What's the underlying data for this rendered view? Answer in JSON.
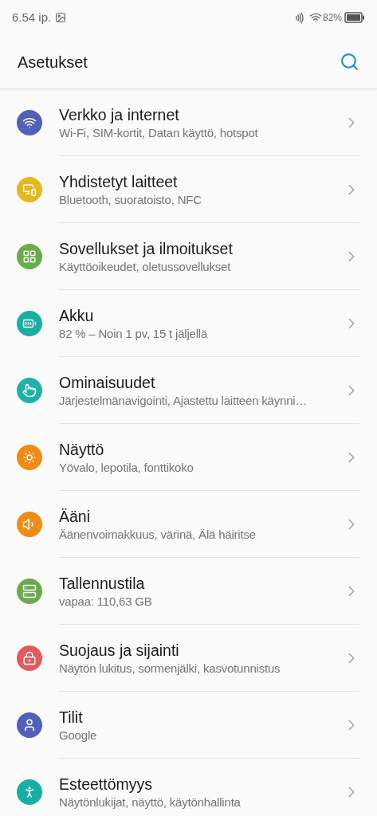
{
  "status_bar": {
    "time": "6.54 ip.",
    "battery": "82%"
  },
  "header": {
    "title": "Asetukset"
  },
  "items": [
    {
      "title": "Verkko ja internet",
      "subtitle": "Wi-Fi, SIM-kortit, Datan käyttö, hotspot",
      "color": "#5160b8"
    },
    {
      "title": "Yhdistetyt laitteet",
      "subtitle": "Bluetooth, suoratoisto, NFC",
      "color": "#e6b81e"
    },
    {
      "title": "Sovellukset ja ilmoitukset",
      "subtitle": "Käyttöoikeudet, oletussovellukset",
      "color": "#6aab4c"
    },
    {
      "title": "Akku",
      "subtitle": "82 % – Noin 1 pv, 15 t jäljellä",
      "color": "#19ada3"
    },
    {
      "title": "Ominaisuudet",
      "subtitle": "Järjestelmänavigointi, Ajastettu laitteen käynni…",
      "color": "#1db3a6"
    },
    {
      "title": "Näyttö",
      "subtitle": "Yövalo, lepotila, fonttikoko",
      "color": "#ef8c16"
    },
    {
      "title": "Ääni",
      "subtitle": "Äänenvoimakkuus, värinä, Älä häiritse",
      "color": "#ef8c16"
    },
    {
      "title": "Tallennustila",
      "subtitle": "vapaa: 110,63 GB",
      "color": "#6aab4c"
    },
    {
      "title": "Suojaus ja sijainti",
      "subtitle": "Näytön lukitus, sormenjälki, kasvotunnistus",
      "color": "#e35a5e"
    },
    {
      "title": "Tilit",
      "subtitle": "Google",
      "color": "#5160b8"
    },
    {
      "title": "Esteettömyys",
      "subtitle": "Näytönlukijat, näyttö, käytönhallinta",
      "color": "#19ada3"
    }
  ]
}
